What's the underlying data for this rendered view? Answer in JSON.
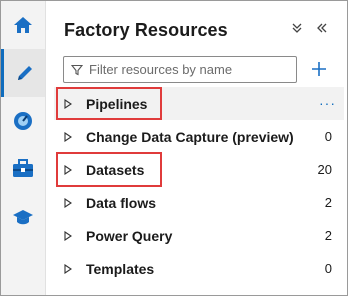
{
  "panel": {
    "title": "Factory Resources",
    "filter_placeholder": "Filter resources by name"
  },
  "icons": {
    "rail": [
      "home-icon",
      "author-pencil-icon",
      "monitor-gauge-icon",
      "manage-toolbox-icon",
      "learning-hat-icon"
    ],
    "collapse": "collapse-all-icon",
    "hide": "hide-panel-icon",
    "filter": "filter-icon",
    "add": "plus-icon",
    "more": "more-options-icon"
  },
  "resources": [
    {
      "label": "Pipelines",
      "count": "",
      "more": "···"
    },
    {
      "label": "Change Data Capture (preview)",
      "count": "0"
    },
    {
      "label": "Datasets",
      "count": "20"
    },
    {
      "label": "Data flows",
      "count": "2"
    },
    {
      "label": "Power Query",
      "count": "2"
    },
    {
      "label": "Templates",
      "count": "0"
    }
  ],
  "colors": {
    "accent": "#0f6cbd",
    "highlight": "#e03b3b"
  }
}
